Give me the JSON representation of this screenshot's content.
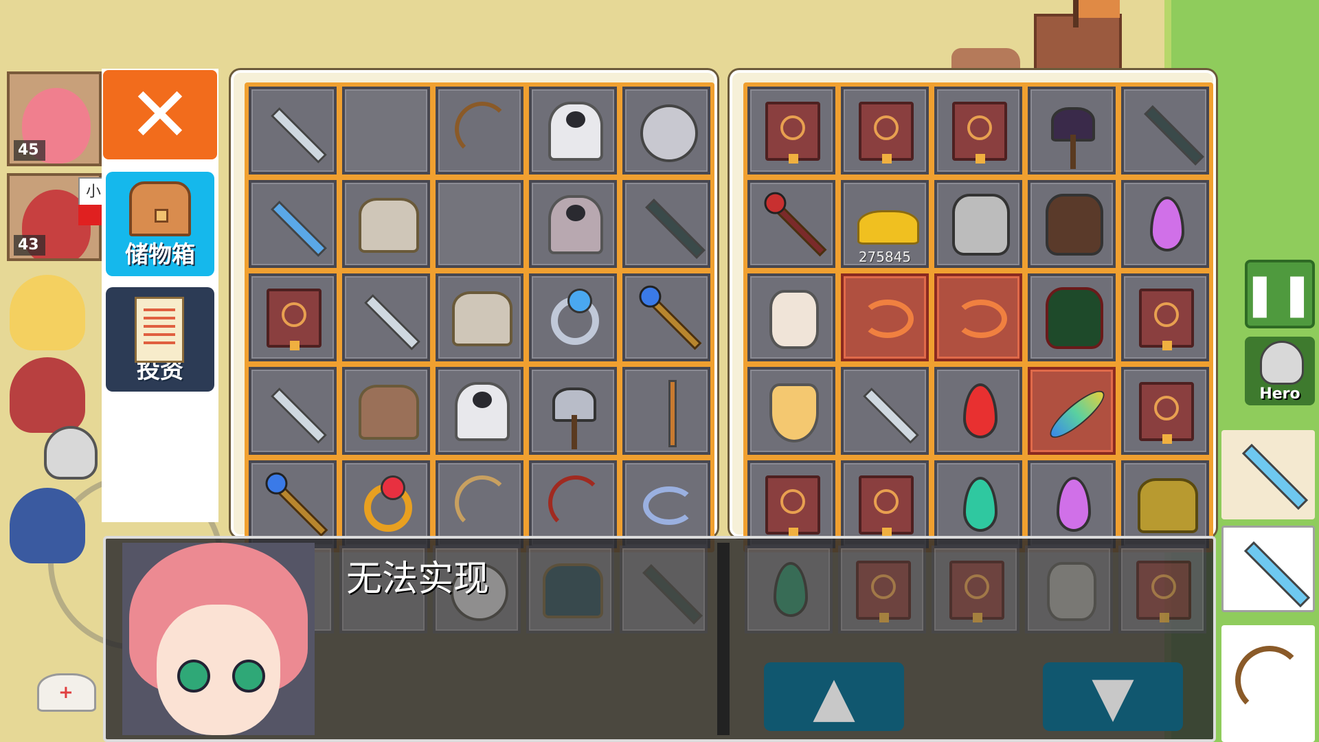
{
  "colors": {
    "close_button": "#f26c1c",
    "storage_button": "#15b8ec",
    "invest_button": "#2c3b55",
    "grid_frame": "#f0a030",
    "slot_fill": "#6f6f78",
    "nav_button": "#10576f",
    "pause_button": "#4f9a3e"
  },
  "party": {
    "members": [
      {
        "level": "45"
      },
      {
        "level": "43",
        "name_tag": "小"
      }
    ]
  },
  "side_menu": {
    "close_symbol": "✕",
    "storage_label": "储物箱",
    "invest_label": "投资"
  },
  "inventory_left": {
    "slots": [
      {
        "item": "sword-icon"
      },
      {
        "item": "empty"
      },
      {
        "item": "bow-icon"
      },
      {
        "item": "white-robe-icon"
      },
      {
        "item": "silver-orb-icon"
      },
      {
        "item": "blue-sword-icon"
      },
      {
        "item": "plate-armor-icon"
      },
      {
        "item": "empty"
      },
      {
        "item": "grey-cloak-icon"
      },
      {
        "item": "dagger-icon"
      },
      {
        "item": "spellbook-icon"
      },
      {
        "item": "short-sword-icon"
      },
      {
        "item": "plate-armor-icon"
      },
      {
        "item": "sapphire-ring-icon"
      },
      {
        "item": "scepter-icon"
      },
      {
        "item": "broadsword-icon"
      },
      {
        "item": "leather-armor-icon"
      },
      {
        "item": "white-cloak-icon"
      },
      {
        "item": "battle-axe-icon"
      },
      {
        "item": "wand-icon"
      },
      {
        "item": "staff-icon"
      },
      {
        "item": "ruby-ring-icon"
      },
      {
        "item": "tan-bow-icon"
      },
      {
        "item": "crossbow-icon"
      },
      {
        "item": "wisp-icon"
      }
    ],
    "hidden_row": [
      {
        "item": "shadow-item-icon"
      },
      {
        "item": "shadow-item-icon"
      },
      {
        "item": "helm-icon"
      },
      {
        "item": "dark-armor-icon"
      },
      {
        "item": "dark-blade-icon"
      }
    ]
  },
  "inventory_right": {
    "slots": [
      {
        "item": "spellbook-icon"
      },
      {
        "item": "spellbook-icon"
      },
      {
        "item": "spellbook-icon"
      },
      {
        "item": "dark-axe-icon"
      },
      {
        "item": "scythe-icon"
      },
      {
        "item": "crimson-staff-icon"
      },
      {
        "item": "gold-coins-icon",
        "count": "275845"
      },
      {
        "item": "skull-shield-icon"
      },
      {
        "item": "skeleton-cape-icon"
      },
      {
        "item": "pink-gem-icon"
      },
      {
        "item": "white-diamond-icon"
      },
      {
        "item": "flame-wisp-icon",
        "highlight": true
      },
      {
        "item": "flame-wisp-icon",
        "highlight": true
      },
      {
        "item": "skull-cape-icon"
      },
      {
        "item": "spellbook-icon"
      },
      {
        "item": "gold-gem-icon"
      },
      {
        "item": "ornate-sword-icon"
      },
      {
        "item": "red-gem-icon"
      },
      {
        "item": "phoenix-feather-icon",
        "highlight": true
      },
      {
        "item": "spellbook-icon"
      },
      {
        "item": "spellbook-icon"
      },
      {
        "item": "spellbook-icon"
      },
      {
        "item": "teal-gem-icon"
      },
      {
        "item": "pink-gem-icon"
      },
      {
        "item": "gold-armor-icon"
      }
    ],
    "hidden_row": [
      {
        "item": "green-gem-icon"
      },
      {
        "item": "spellbook-icon"
      },
      {
        "item": "spellbook-icon"
      },
      {
        "item": "grey-diamond-icon"
      },
      {
        "item": "spellbook-icon"
      }
    ]
  },
  "message": {
    "text": "无法实现"
  },
  "nav": {
    "up_symbol": "▲",
    "down_symbol": "▼"
  },
  "hud": {
    "pause_symbol": "❚❚",
    "hero_label": "Hero"
  }
}
